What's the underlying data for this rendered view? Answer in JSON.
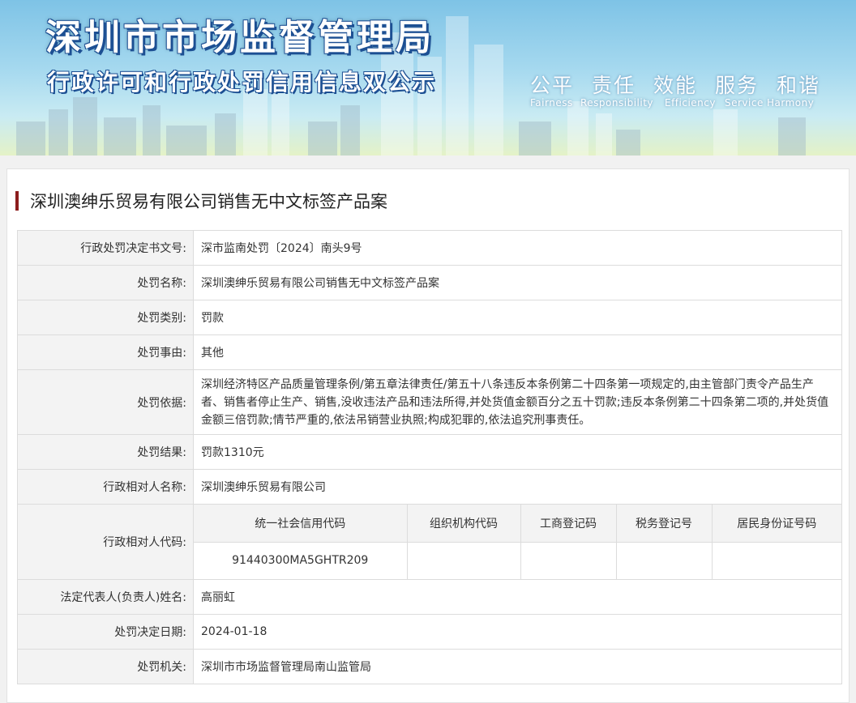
{
  "banner": {
    "title": "深圳市市场监督管理局",
    "subtitle": "行政许可和行政处罚信用信息双公示",
    "slogans_cn": [
      "公平",
      "责任",
      "效能",
      "服务",
      "和谐"
    ],
    "slogans_en": [
      "Fairness",
      "Responsibility",
      "Efficiency",
      "Service",
      "Harmony"
    ]
  },
  "case": {
    "title": "深圳澳绅乐贸易有限公司销售无中文标签产品案"
  },
  "rows": {
    "decision_no": {
      "label": "行政处罚决定书文号:",
      "value": "深市监南处罚〔2024〕南头9号"
    },
    "name": {
      "label": "处罚名称:",
      "value": "深圳澳绅乐贸易有限公司销售无中文标签产品案"
    },
    "category": {
      "label": "处罚类别:",
      "value": "罚款"
    },
    "reason": {
      "label": "处罚事由:",
      "value": "其他"
    },
    "basis": {
      "label": "处罚依据:",
      "value": "深圳经济特区产品质量管理条例/第五章法律责任/第五十八条违反本条例第二十四条第一项规定的,由主管部门责令产品生产者、销售者停止生产、销售,没收违法产品和违法所得,并处货值金额百分之五十罚款;违反本条例第二十四条第二项的,并处货值金额三倍罚款;情节严重的,依法吊销营业执照;构成犯罪的,依法追究刑事责任。"
    },
    "result": {
      "label": "处罚结果:",
      "value": "罚款1310元"
    },
    "party": {
      "label": "行政相对人名称:",
      "value": "深圳澳绅乐贸易有限公司"
    },
    "codes": {
      "label": "行政相对人代码:",
      "headers": [
        "统一社会信用代码",
        "组织机构代码",
        "工商登记码",
        "税务登记号",
        "居民身份证号码"
      ],
      "values": [
        "91440300MA5GHTR209",
        "",
        "",
        "",
        ""
      ]
    },
    "legal_rep": {
      "label": "法定代表人(负责人)姓名:",
      "value": "高丽虹"
    },
    "date": {
      "label": "处罚决定日期:",
      "value": "2024-01-18"
    },
    "authority": {
      "label": "处罚机关:",
      "value": "深圳市市场监督管理局南山监管局"
    }
  }
}
